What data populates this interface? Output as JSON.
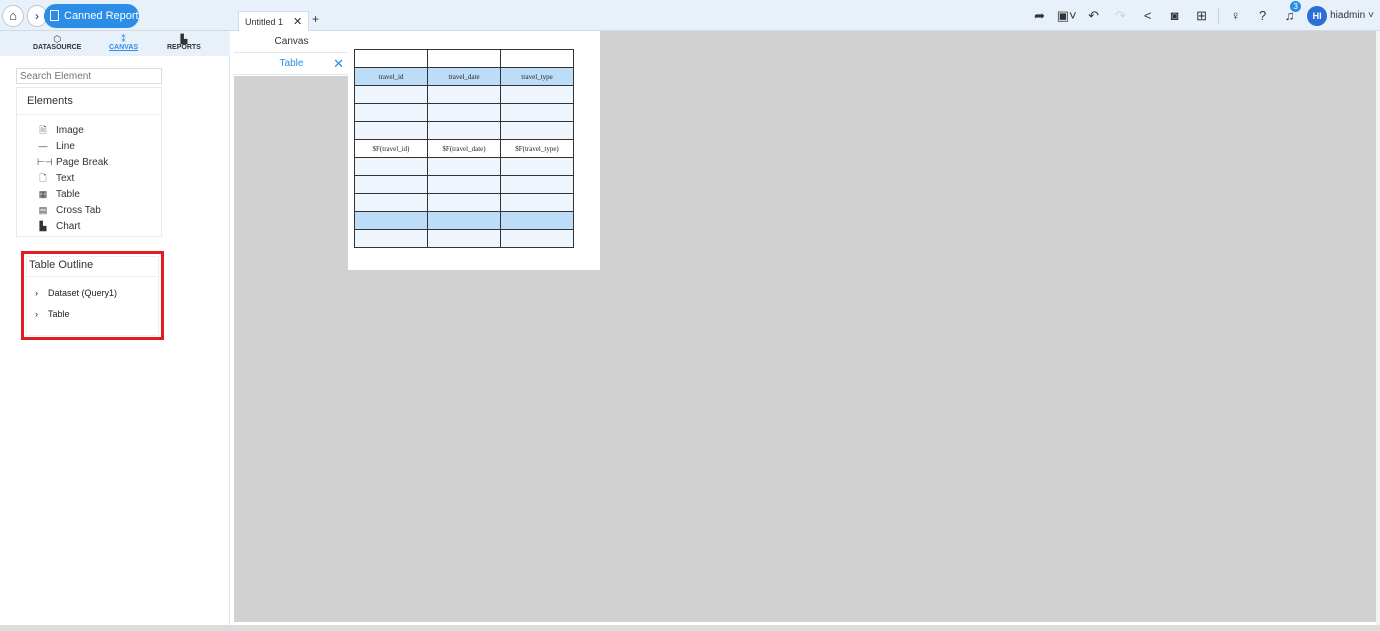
{
  "breadcrumb": {
    "home_icon": "home-icon",
    "canned_report_label": "Canned Report"
  },
  "doc_tabs": {
    "active_tab": "Untitled 1",
    "add_icon": "+"
  },
  "toolbar": {
    "icons": [
      "share-forward-icon",
      "save-icon",
      "undo-icon",
      "redo-icon",
      "share-icon",
      "preview-icon",
      "layout-icon",
      "bulb-icon",
      "help-icon",
      "bell-icon"
    ],
    "notification_count": "3",
    "user_initials": "HI",
    "username": "hiadmin"
  },
  "side_tabs": [
    {
      "label": "DATASOURCE",
      "icon": "cube-icon"
    },
    {
      "label": "CANVAS",
      "icon": "canvas-icon"
    },
    {
      "label": "REPORTS",
      "icon": "chart-icon"
    }
  ],
  "search": {
    "placeholder": "Search Element"
  },
  "elements": {
    "title": "Elements",
    "items": [
      {
        "label": "Image",
        "icon": "image-icon"
      },
      {
        "label": "Line",
        "icon": "line-icon"
      },
      {
        "label": "Page Break",
        "icon": "page-break-icon"
      },
      {
        "label": "Text",
        "icon": "text-icon"
      },
      {
        "label": "Table",
        "icon": "table-icon"
      },
      {
        "label": "Cross Tab",
        "icon": "cross-tab-icon"
      },
      {
        "label": "Chart",
        "icon": "chart-icon"
      }
    ]
  },
  "table_outline": {
    "title": "Table Outline",
    "items": [
      "Dataset (Query1)",
      "Table"
    ]
  },
  "sub_tabs": {
    "canvas": "Canvas",
    "table": "Table"
  },
  "report_table": {
    "headers": [
      "travel_id",
      "travel_date",
      "travel_type"
    ],
    "fields": [
      "$F(travel_id)",
      "$F(travel_date)",
      "$F(travel_type)"
    ]
  },
  "colors": {
    "accent": "#2b8de6",
    "highlight_border": "#e01b24",
    "header_row": "#bcdcf7",
    "work_area": "#d1d1d1"
  }
}
